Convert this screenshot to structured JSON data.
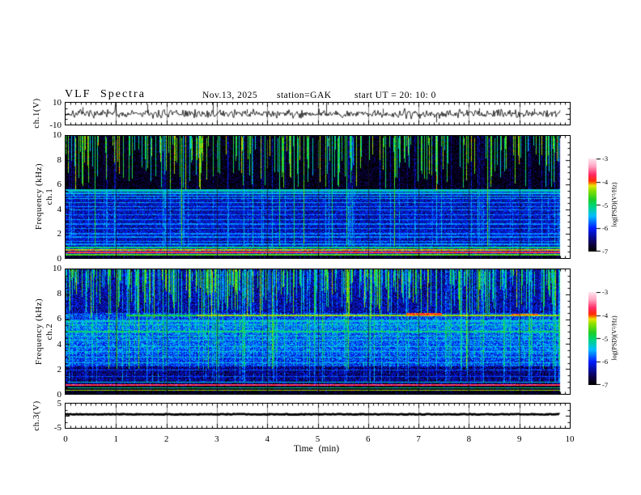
{
  "header": {
    "title": "VLF Spectra",
    "date": "Nov.13, 2025",
    "station": "station=GAK",
    "start_ut": "start UT =  20: 10: 0"
  },
  "labels": {
    "ch1_wave": "ch.1(V)",
    "ch1": "ch.1",
    "ch2": "ch.2",
    "freq": "Frequency  (kHz)",
    "ch3": "ch.3(V)",
    "time": "Time  (min)",
    "psd": "log(PSD)(V²/Hz)"
  },
  "chart_data": {
    "type": "heatmap",
    "title": "VLF Spectra",
    "date": "Nov.13, 2025",
    "station": "GAK",
    "start_ut": "20:10:0",
    "x_axis": {
      "label": "Time (min)",
      "min": 0,
      "max": 10,
      "data_end": 9.8,
      "ticks": [
        "0",
        "1",
        "2",
        "3",
        "4",
        "5",
        "6",
        "7",
        "8",
        "9",
        "10"
      ]
    },
    "colorbar": {
      "label": "log(PSD)(V²/Hz)",
      "min": -7,
      "max": -3,
      "ticks": [
        "-3",
        "-4",
        "-5",
        "-6",
        "-7"
      ]
    },
    "panels": [
      {
        "id": "ch1_wave",
        "type": "line",
        "ylabel": "ch.1(V)",
        "ylim": [
          -10,
          10
        ],
        "yticks": [
          "10",
          "-10"
        ],
        "seed": 7,
        "noise_v": 0.9,
        "spikes": [
          [
            0.33,
            6
          ],
          [
            1.0,
            5
          ],
          [
            1.62,
            8.5
          ],
          [
            2.92,
            11
          ],
          [
            3.6,
            4
          ],
          [
            5.17,
            10
          ],
          [
            6.3,
            4.5
          ],
          [
            7.35,
            -8
          ],
          [
            8.2,
            5
          ],
          [
            9.3,
            4.5
          ]
        ]
      },
      {
        "id": "ch1_spec",
        "type": "heatmap",
        "ylabel": "ch.1 Frequency (kHz)",
        "ylim": [
          0,
          10
        ],
        "yticks": [
          "10",
          "8",
          "6",
          "4",
          "2",
          "0"
        ],
        "seed": 101,
        "jitter": 0.45,
        "profile": [
          [
            0,
            0.18,
            -6.8
          ],
          [
            0.18,
            1.0,
            -6.1
          ],
          [
            1.0,
            5.65,
            -6.25
          ],
          [
            5.65,
            10,
            -6.95
          ]
        ],
        "lines": [
          [
            0.88,
            -5.0,
            0.07
          ],
          [
            0.68,
            -4.2,
            0.07
          ],
          [
            0.47,
            -3.8,
            0.06
          ],
          [
            0.28,
            -4.6,
            0.06
          ],
          [
            1.12,
            -5.6,
            0.04
          ],
          [
            1.38,
            -5.7,
            0.04
          ],
          [
            1.72,
            -5.65,
            0.04
          ],
          [
            1.98,
            -5.7,
            0.04
          ],
          [
            2.42,
            -5.65,
            0.04
          ],
          [
            2.78,
            -5.7,
            0.04
          ],
          [
            3.12,
            -5.65,
            0.04
          ],
          [
            3.55,
            -5.7,
            0.04
          ],
          [
            3.92,
            -5.65,
            0.04
          ],
          [
            4.2,
            -5.7,
            0.04
          ],
          [
            4.55,
            -5.6,
            0.04
          ],
          [
            4.85,
            -5.55,
            0.04
          ],
          [
            5.08,
            -5.45,
            0.04
          ],
          [
            5.3,
            -5.4,
            0.04
          ],
          [
            5.5,
            -5.25,
            0.05
          ],
          [
            5.62,
            -5.35,
            0.04
          ]
        ],
        "streaks": {
          "prob": 0.33,
          "fmin": 5.5,
          "frange": 3.8,
          "lmin": -5.3,
          "lrange": 1.0,
          "full_prob": 0.07,
          "full_bottom": 1.0
        },
        "col_boost_prob": 0.12
      },
      {
        "id": "ch2_spec",
        "type": "heatmap",
        "ylabel": "ch.2 Frequency (kHz)",
        "ylim": [
          0,
          10
        ],
        "yticks": [
          "10",
          "8",
          "6",
          "4",
          "2",
          "0"
        ],
        "seed": 202,
        "jitter": 0.5,
        "profile": [
          [
            0,
            0.8,
            -6.9
          ],
          [
            0.8,
            2.2,
            -6.5
          ],
          [
            2.2,
            3.2,
            -5.95
          ],
          [
            3.2,
            4.9,
            -5.8
          ],
          [
            4.9,
            6.0,
            -5.65
          ],
          [
            6.0,
            6.5,
            -5.95
          ],
          [
            6.5,
            10,
            -6.35
          ]
        ],
        "lines": [
          [
            0.7,
            -3.7,
            0.05
          ],
          [
            0.5,
            -5.0,
            0.05
          ],
          [
            0.3,
            -4.3,
            0.05
          ],
          [
            0.95,
            -5.3,
            0.04
          ],
          [
            1.4,
            -5.9,
            0.04
          ],
          [
            1.9,
            -5.85,
            0.04
          ],
          [
            2.5,
            -5.5,
            0.04
          ],
          [
            2.95,
            -5.45,
            0.04
          ],
          [
            3.4,
            -5.5,
            0.04
          ],
          [
            3.8,
            -5.45,
            0.04
          ],
          [
            4.3,
            -5.4,
            0.04
          ],
          [
            4.65,
            -5.35,
            0.04
          ],
          [
            5.0,
            -5.05,
            0.07
          ],
          [
            5.55,
            -5.35,
            0.05
          ],
          [
            5.85,
            -5.4,
            0.04
          ],
          [
            6.3,
            -4.8,
            0.07,
            1.2,
            9.8
          ],
          [
            6.3,
            -4.35,
            0.08,
            2.6,
            9.8
          ],
          [
            6.38,
            -3.9,
            0.09,
            6.75,
            7.45
          ],
          [
            6.38,
            -4.0,
            0.07,
            8.85,
            9.35
          ]
        ],
        "streaks": {
          "prob": 0.45,
          "fmin": 6.0,
          "frange": 3.5,
          "lmin": -5.6,
          "lrange": 1.2,
          "full_prob": 0.05,
          "full_bottom": 2.0
        },
        "col_boost_prob": 0.15
      },
      {
        "id": "ch3_wave",
        "type": "line",
        "ylabel": "ch.3(V)",
        "ylim": [
          -5,
          5
        ],
        "yticks": [
          "5",
          "-5"
        ],
        "seed": 9,
        "value": 0.6,
        "spikes": []
      }
    ]
  }
}
